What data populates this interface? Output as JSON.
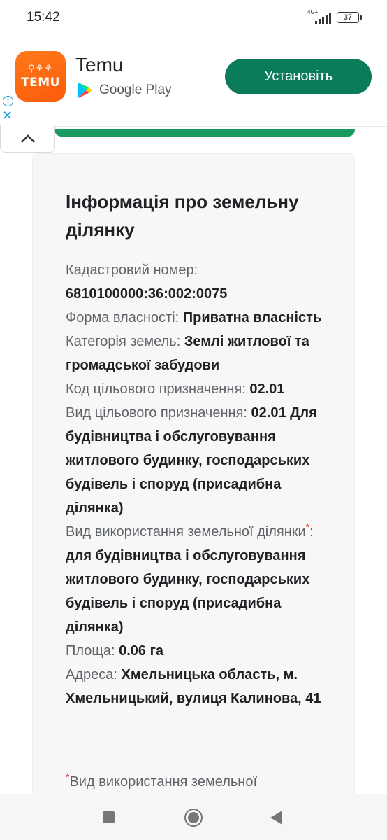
{
  "status_bar": {
    "time": "15:42",
    "network": "4G+",
    "battery": "37"
  },
  "ad": {
    "logo_text": "TEMU",
    "app_name": "Temu",
    "store": "Google Play",
    "install_label": "Установіть",
    "info_icon": "info-icon",
    "close_icon": "close-icon",
    "colors": {
      "install": "#0b7c59",
      "logo": "#fb5b0a"
    }
  },
  "card": {
    "title": "Інформація про земельну ділянку",
    "fields": {
      "cadastral_label": "Кадастровий номер:",
      "cadastral_value": "6810100000:36:002:0075",
      "ownership_label": "Форма власності:",
      "ownership_value": "Приватна власність",
      "category_label": "Категорія земель:",
      "category_value": "Землі житлової та громадської забудови",
      "purpose_code_label": "Код цільового призначення:",
      "purpose_code_value": "02.01",
      "purpose_type_label": "Вид цільового призначення:",
      "purpose_type_value": "02.01 Для будівництва і обслуговування житлового будинку, господарських будівель і споруд (присадибна ділянка)",
      "usage_label": "Вид використання земельної ділянки",
      "usage_required_mark": "*",
      "usage_value": "для будівництва і обслуговування житлового будинку, господарських будівель і споруд (присадибна ділянка)",
      "area_label": "Площа:",
      "area_value": "0.06 га",
      "address_label": "Адреса:",
      "address_value": "Хмельницька область, м. Хмельницький, вулиця Калинова, 41"
    },
    "footnote_mark": "*",
    "footnote_text": "Вид використання земельної"
  },
  "nav": {
    "recents": "square-icon",
    "home": "home-icon",
    "back": "back-icon"
  }
}
